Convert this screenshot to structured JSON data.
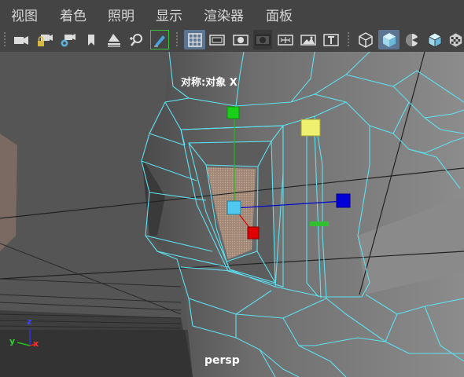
{
  "menu": {
    "items": [
      "视图",
      "着色",
      "照明",
      "显示",
      "渲染器",
      "面板"
    ]
  },
  "toolbar": {
    "tools": [
      {
        "name": "camera-select-icon",
        "active": false
      },
      {
        "name": "camera-lock-icon",
        "active": false
      },
      {
        "name": "camera-attributes-icon",
        "active": false
      },
      {
        "name": "bookmark-icon",
        "active": false
      },
      {
        "name": "image-plane-icon",
        "active": false
      },
      {
        "name": "two-d-pan-zoom-icon",
        "active": false
      },
      {
        "name": "grease-pencil-icon",
        "active": true
      },
      {
        "name": "grid-icon",
        "active": true
      },
      {
        "name": "film-gate-icon",
        "active": false
      },
      {
        "name": "resolution-gate-icon",
        "active": false
      },
      {
        "name": "gate-mask-icon",
        "active": false
      },
      {
        "name": "field-chart-icon",
        "active": false
      },
      {
        "name": "safe-action-icon",
        "active": false
      },
      {
        "name": "safe-title-icon",
        "active": false
      },
      {
        "name": "wireframe-cube-icon",
        "active": false
      },
      {
        "name": "smooth-shade-cube-icon",
        "active": true
      },
      {
        "name": "default-material-icon",
        "active": false
      },
      {
        "name": "wireframe-on-shaded-icon",
        "active": false
      },
      {
        "name": "textured-icon",
        "active": false
      }
    ]
  },
  "viewport": {
    "symmetry_label": "对称:对象 X",
    "camera_label": "persp",
    "axes": {
      "x": "x",
      "y": "y",
      "z": "z"
    }
  },
  "colors": {
    "wire": "#5fe0f0",
    "accent": "#5b7592",
    "manip_x": "#0000d0",
    "manip_y": "#18c018",
    "manip_z": "#e00000",
    "manip_center": "#50c8f0",
    "manip_plane": "#f0f070"
  }
}
